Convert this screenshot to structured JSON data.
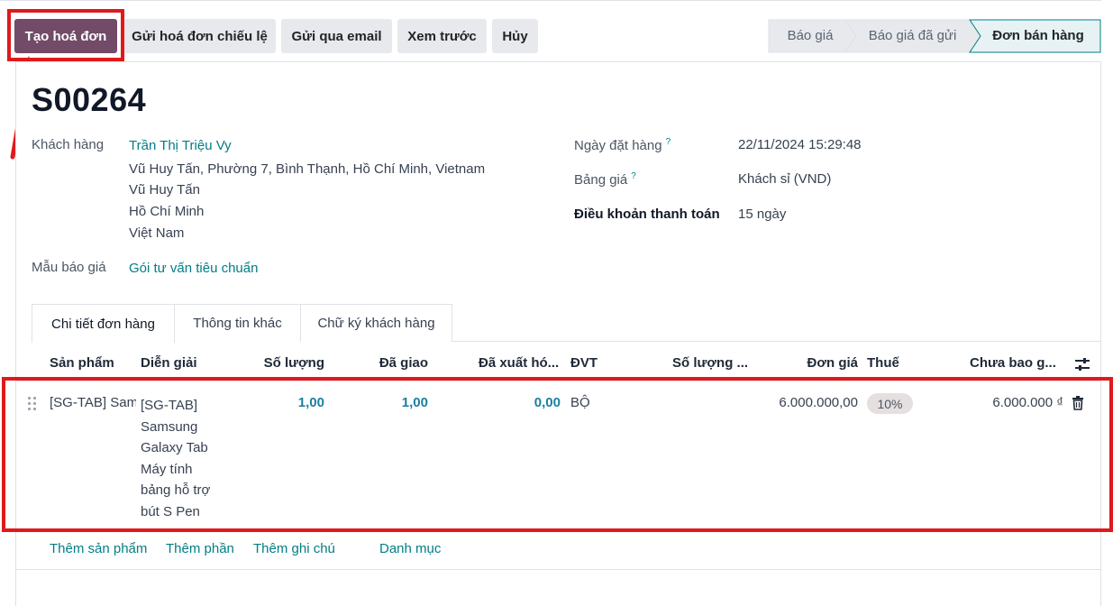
{
  "actions": {
    "create_invoice": "Tạo hoá đơn",
    "send_proforma": "Gửi hoá đơn chiếu lệ",
    "send_email": "Gửi qua email",
    "preview": "Xem trước",
    "cancel": "Hủy"
  },
  "statusbar": [
    "Báo giá",
    "Báo giá đã gửi",
    "Đơn bán hàng"
  ],
  "record": {
    "name": "S00264",
    "customer_label": "Khách hàng",
    "customer_name": "Trần Thị Triệu Vy",
    "address_lines": [
      "Vũ Huy Tấn, Phường 7, Bình Thạnh, Hồ Chí Minh, Vietnam",
      "Vũ Huy Tấn",
      "Hồ Chí Minh",
      "Việt Nam"
    ],
    "template_label": "Mẫu báo giá",
    "template_value": "Gói tư vấn tiêu chuẩn",
    "order_date_label": "Ngày đặt hàng",
    "order_date_value": "22/11/2024 15:29:48",
    "pricelist_label": "Bảng giá",
    "pricelist_value": "Khách sỉ (VND)",
    "payment_terms_label": "Điều khoản thanh toán",
    "payment_terms_value": "15 ngày",
    "help_mark": "?"
  },
  "tabs": [
    "Chi tiết đơn hàng",
    "Thông tin khác",
    "Chữ ký khách hàng"
  ],
  "table": {
    "headers": [
      "Sản phẩm",
      "Diễn giải",
      "Số lượng",
      "Đã giao",
      "Đã xuất hó...",
      "ĐVT",
      "Số lượng ...",
      "Đơn giá",
      "Thuế",
      "Chưa bao g..."
    ],
    "row": {
      "product": "[SG-TAB] Sam",
      "description": "[SG-TAB]\nSamsung\nGalaxy Tab\nMáy tính\nbảng hỗ trợ\nbút S Pen",
      "qty": "1,00",
      "delivered": "1,00",
      "invoiced": "0,00",
      "uom": "BỘ",
      "unit_price": "6.000.000,00",
      "tax": "10%",
      "subtotal": "6.000.000 ₫"
    }
  },
  "add_links": [
    "Thêm sản phẩm",
    "Thêm phần",
    "Thêm ghi chú",
    "Danh mục"
  ],
  "colors": {
    "primary": "#714b67",
    "link": "#017e84",
    "annotation_red": "#e0191b"
  }
}
